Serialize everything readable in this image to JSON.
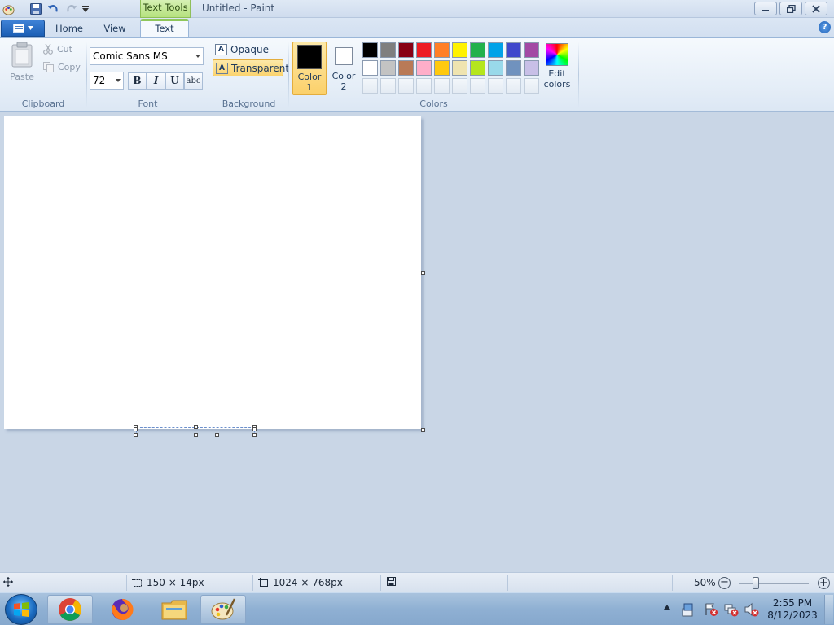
{
  "window": {
    "title": "Untitled - Paint",
    "context_tab": "Text Tools"
  },
  "tabs": [
    {
      "label": "Home",
      "active": false
    },
    {
      "label": "View",
      "active": false
    },
    {
      "label": "Text",
      "active": true
    }
  ],
  "ribbon": {
    "clipboard": {
      "label": "Clipboard",
      "paste": "Paste",
      "cut": "Cut",
      "copy": "Copy"
    },
    "font": {
      "label": "Font",
      "family": "Comic Sans MS",
      "size": "72",
      "bold": "B",
      "italic": "I",
      "underline": "U",
      "strikethrough": "abc"
    },
    "background": {
      "label": "Background",
      "opaque": "Opaque",
      "transparent": "Transparent",
      "selected": "transparent"
    },
    "colors": {
      "label": "Colors",
      "color1_line1": "Color",
      "color1_line2": "1",
      "color2_line1": "Color",
      "color2_line2": "2",
      "color1_value": "#000000",
      "color2_value": "#ffffff",
      "edit_line1": "Edit",
      "edit_line2": "colors",
      "palette_row1": [
        "#000000",
        "#7f7f7f",
        "#880015",
        "#ed1c24",
        "#ff7f27",
        "#fff200",
        "#22b14c",
        "#00a2e8",
        "#3f48cc",
        "#a349a4"
      ],
      "palette_row2": [
        "#ffffff",
        "#c3c3c3",
        "#b97a57",
        "#ffaec9",
        "#ffc90e",
        "#efe4b0",
        "#b5e61d",
        "#99d9ea",
        "#7092be",
        "#c8bfe7"
      ]
    }
  },
  "status": {
    "selection_size": "150 × 14px",
    "image_size": "1024 × 768px",
    "zoom": "50%"
  },
  "clock": {
    "time": "2:55 PM",
    "date": "8/12/2023"
  }
}
